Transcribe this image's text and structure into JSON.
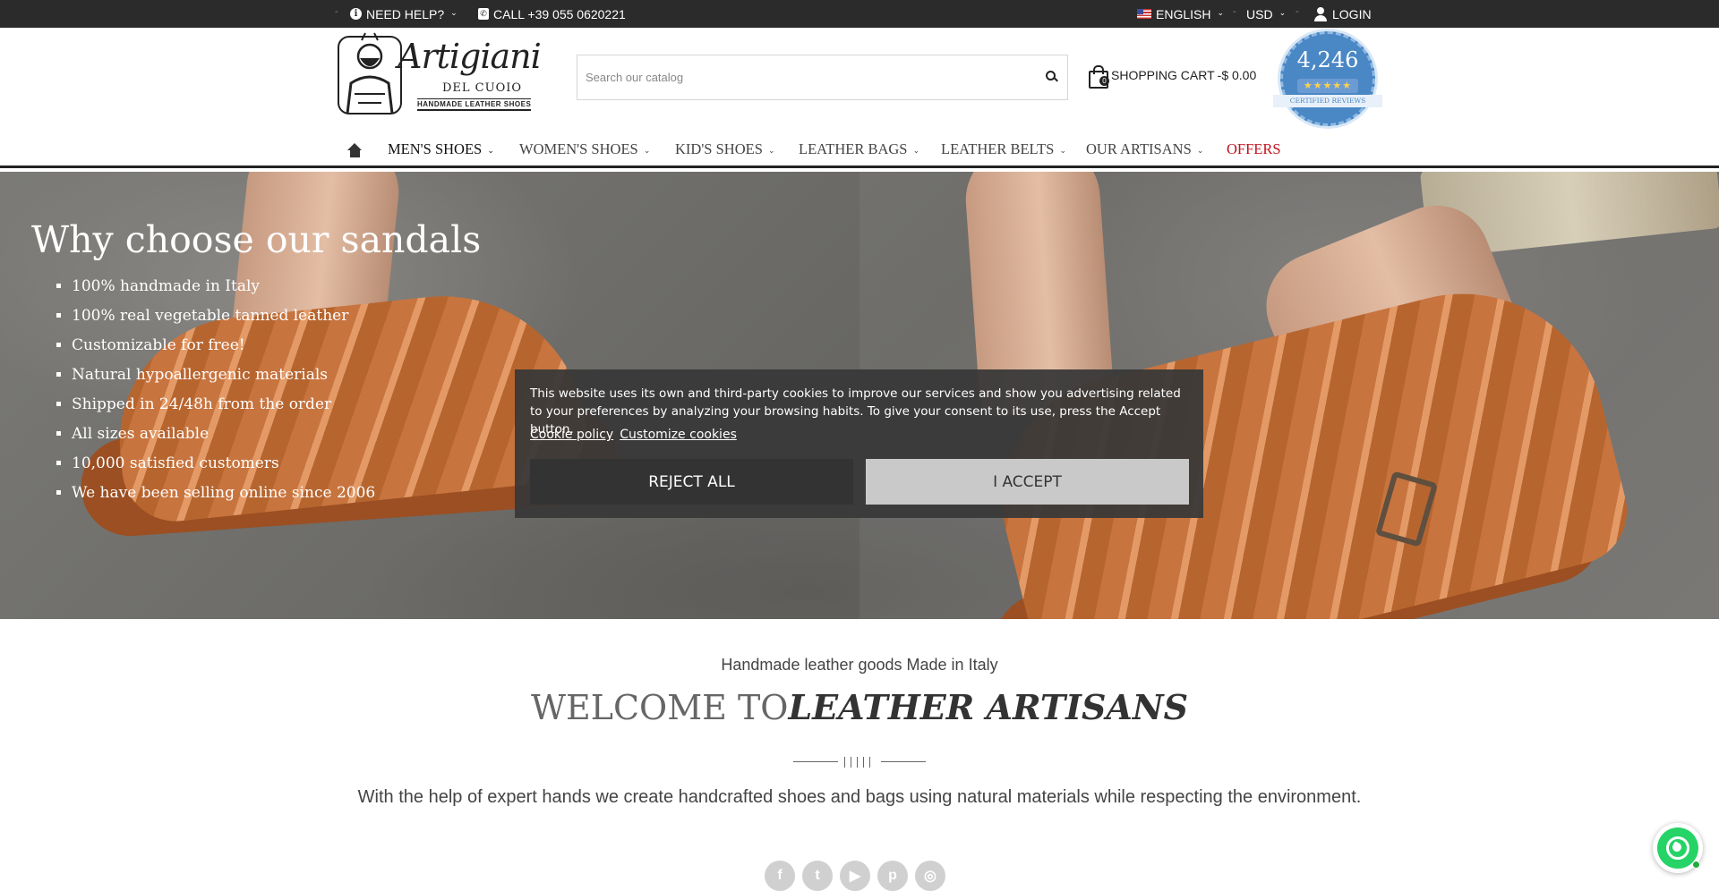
{
  "topbar": {
    "help_label": "NEED HELP?",
    "call_label": "CALL +39 055 0620221",
    "language": "ENGLISH",
    "currency": "USD",
    "login_label": "LOGIN",
    "separator": "-"
  },
  "logo": {
    "title": "Artigiani",
    "subtitle": "DEL CUOIO",
    "tagline": "HANDMADE LEATHER SHOES"
  },
  "search": {
    "placeholder": "Search our catalog"
  },
  "cart": {
    "label": "SHOPPING CART",
    "total": "-$ 0.00",
    "count": "0"
  },
  "reviews_badge": {
    "count": "4,246",
    "stars": "★★★★★",
    "label": "CERTIFIED REVIEWS"
  },
  "nav": {
    "items": [
      {
        "label": "MEN'S SHOES"
      },
      {
        "label": "WOMEN'S SHOES"
      },
      {
        "label": "KID'S SHOES"
      },
      {
        "label": "LEATHER BAGS"
      },
      {
        "label": "LEATHER BELTS"
      },
      {
        "label": "OUR ARTISANS"
      },
      {
        "label": "OFFERS"
      }
    ]
  },
  "hero": {
    "title": "Why choose our sandals",
    "bullets": [
      "100% handmade in Italy",
      "100% real vegetable tanned leather",
      "Customizable for free!",
      "Natural hypoallergenic materials",
      "Shipped in 24/48h from the order",
      "All sizes available",
      "10,000 satisfied customers",
      "We have been selling online since 2006"
    ]
  },
  "cookie": {
    "message": "This website uses its own and third-party cookies to improve our services and show you advertising related to your preferences by analyzing your browsing habits. To give your consent to its use, press the Accept button.",
    "policy_link": "Cookie policy",
    "customize_link": "Customize cookies",
    "reject_label": "REJECT ALL",
    "accept_label": "I ACCEPT"
  },
  "welcome": {
    "tagline": "Handmade leather goods Made in Italy",
    "heading_prefix": "WELCOME TO",
    "heading_brand": "LEATHER ARTISANS",
    "intro": "With the help of expert hands we create handcrafted shoes and bags using natural materials while respecting the environment."
  },
  "socials": [
    {
      "icon": "facebook-icon",
      "glyph": "f"
    },
    {
      "icon": "twitter-icon",
      "glyph": "t"
    },
    {
      "icon": "youtube-icon",
      "glyph": "▶"
    },
    {
      "icon": "pinterest-icon",
      "glyph": "p"
    },
    {
      "icon": "instagram-icon",
      "glyph": "◎"
    }
  ],
  "colors": {
    "topbar_bg": "#2b2b2b",
    "offers": "#c1121f",
    "badge_blue": "#4a87c5",
    "whatsapp": "#25d366"
  }
}
